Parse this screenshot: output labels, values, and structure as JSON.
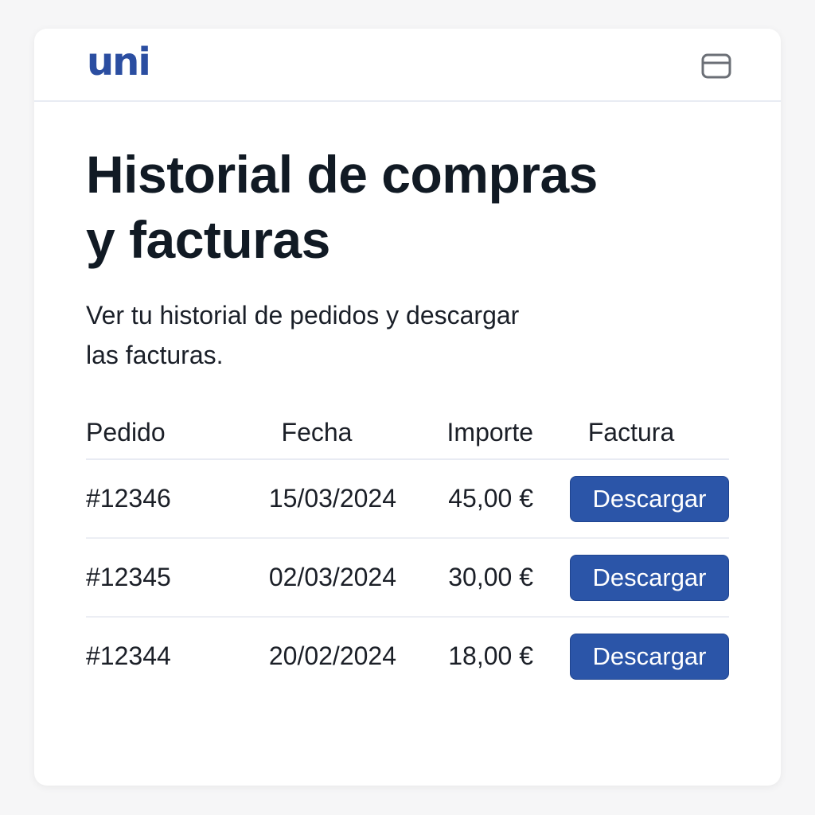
{
  "header": {
    "logo": "uni",
    "card_icon": "credit-card-icon"
  },
  "page": {
    "title_line1": "Historial de compras",
    "title_line2": "y facturas",
    "subtitle_line1": "Ver tu historial de pedidos y descargar",
    "subtitle_line2": "las facturas."
  },
  "table": {
    "columns": [
      "Pedido",
      "Fecha",
      "Importe",
      "Factura"
    ],
    "rows": [
      {
        "order": "#12346",
        "date": "15/03/2024",
        "amount": "45,00 €",
        "action": "Descargar"
      },
      {
        "order": "#12345",
        "date": "02/03/2024",
        "amount": "30,00 €",
        "action": "Descargar"
      },
      {
        "order": "#12344",
        "date": "20/02/2024",
        "amount": "18,00 €",
        "action": "Descargar"
      }
    ]
  },
  "colors": {
    "accent": "#2b55a8",
    "logo": "#2b4ea1",
    "text": "#111a24"
  }
}
